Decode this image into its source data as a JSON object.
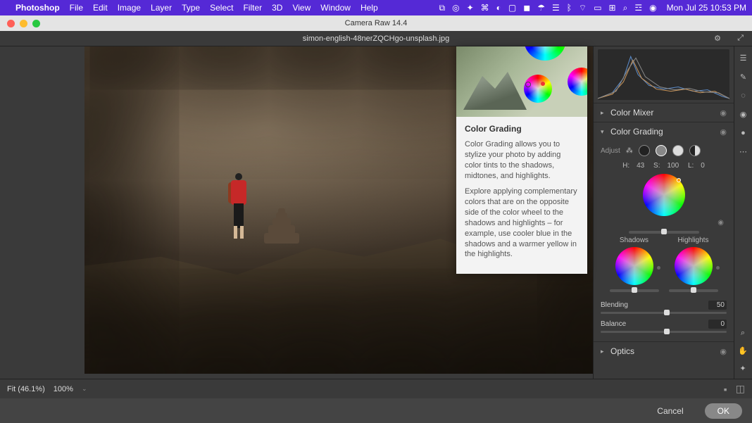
{
  "menubar": {
    "app": "Photoshop",
    "menus": [
      "File",
      "Edit",
      "Image",
      "Layer",
      "Type",
      "Select",
      "Filter",
      "3D",
      "View",
      "Window",
      "Help"
    ],
    "datetime": "Mon Jul 25  10:53 PM"
  },
  "window": {
    "title": "Camera Raw 14.4"
  },
  "subheader": {
    "filename": "simon-english-48nerZQCHgo-unsplash.jpg"
  },
  "tooltip": {
    "title": "Color Grading",
    "p1": "Color Grading allows you to stylize your photo by adding color tints to the shadows, midtones, and highlights.",
    "p2": "Explore applying complementary colors that are on the opposite side of the color wheel to the shadows and highlights – for example, use cooler blue in the shadows and a warmer yellow in the highlights."
  },
  "panel": {
    "sections": {
      "color_mixer": "Color Mixer",
      "color_grading": "Color Grading",
      "optics": "Optics"
    },
    "adjust_label": "Adjust",
    "hsl": {
      "h_label": "H:",
      "h": "43",
      "s_label": "S:",
      "s": "100",
      "l_label": "L:",
      "l": "0"
    },
    "shadows_label": "Shadows",
    "highlights_label": "Highlights",
    "blending": {
      "label": "Blending",
      "value": "50"
    },
    "balance": {
      "label": "Balance",
      "value": "0"
    }
  },
  "bottombar": {
    "fit": "Fit (46.1%)",
    "zoom100": "100%"
  },
  "buttons": {
    "cancel": "Cancel",
    "ok": "OK"
  }
}
